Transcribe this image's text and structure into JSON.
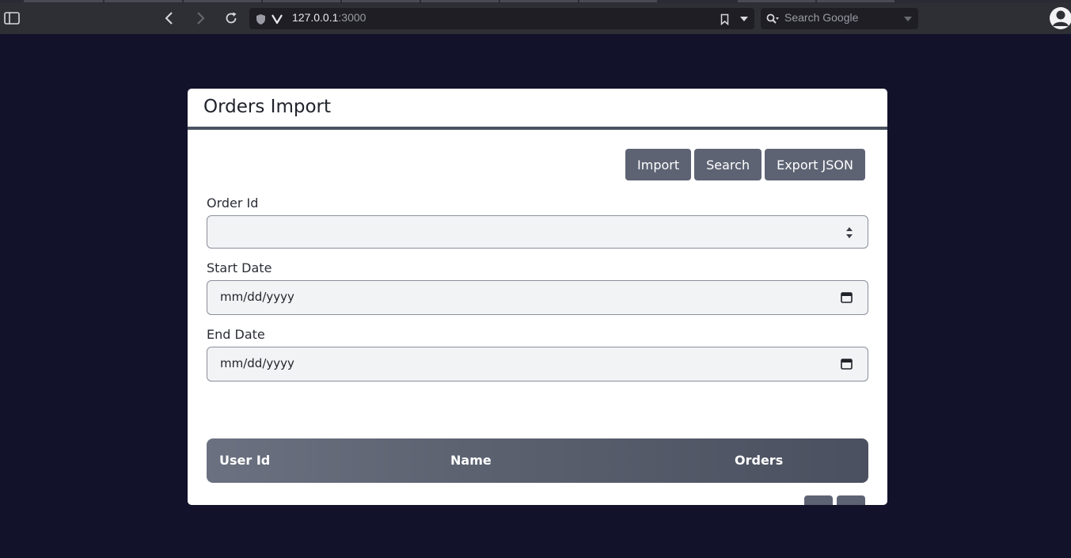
{
  "browser": {
    "url_host": "127.0.0.1",
    "url_port": ":3000",
    "search_placeholder": "Search Google"
  },
  "page": {
    "title": "Orders Import",
    "actions": {
      "import_label": "Import",
      "search_label": "Search",
      "export_label": "Export JSON"
    },
    "form": {
      "order_id_label": "Order Id",
      "order_id_value": "",
      "start_date_label": "Start Date",
      "start_date_value": "mm/dd/yyyy",
      "end_date_label": "End Date",
      "end_date_value": "mm/dd/yyyy"
    },
    "table": {
      "columns": [
        "User Id",
        "Name",
        "Orders"
      ]
    },
    "pager": {
      "prev_label": "-",
      "next_label": "+"
    }
  },
  "colors": {
    "page_bg": "#12122a",
    "button_bg": "#5d6373",
    "header_rule": "#4b5261"
  }
}
